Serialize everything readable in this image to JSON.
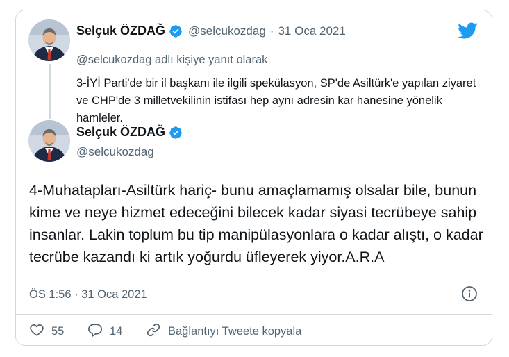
{
  "reply_tweet": {
    "author_name": "Selçuk ÖZDAĞ",
    "author_handle": "@selcukozdag",
    "separator": "·",
    "date": "31 Oca 2021",
    "reply_context": "@selcukozdag adlı kişiye yanıt olarak",
    "text": "3-İYİ Parti'de bir il başkanı ile ilgili spekülasyon, SP'de Asiltürk'e yapılan ziyaret ve CHP'de 3 milletvekilinin istifası hep aynı adresin kar hanesine yönelik hamleler."
  },
  "main_tweet": {
    "author_name": "Selçuk ÖZDAĞ",
    "author_handle": "@selcukozdag",
    "text": "4-Muhatapları-Asiltürk hariç- bunu amaçlamamış olsalar bile, bunun kime ve neye hizmet edeceğini bilecek kadar siyasi tecrübeye sahip insanlar. Lakin toplum bu tip manipülasyonlara o kadar alıştı, o kadar tecrübe kazandı ki artık yoğurdu üfleyerek yiyor.A.R.A",
    "timestamp": "ÖS 1:56 · 31 Oca 2021"
  },
  "actions": {
    "like_count": "55",
    "reply_count": "14",
    "copy_link_label": "Bağlantıyı Tweete kopyala"
  },
  "icons": {
    "brand": "twitter-bird-icon",
    "verified": "verified-badge-icon",
    "info": "info-icon",
    "like": "heart-icon",
    "reply": "speech-bubble-icon",
    "link": "link-icon"
  },
  "colors": {
    "twitter_blue": "#1d9bf0",
    "secondary_text": "#536471",
    "border": "#cfd9de"
  }
}
